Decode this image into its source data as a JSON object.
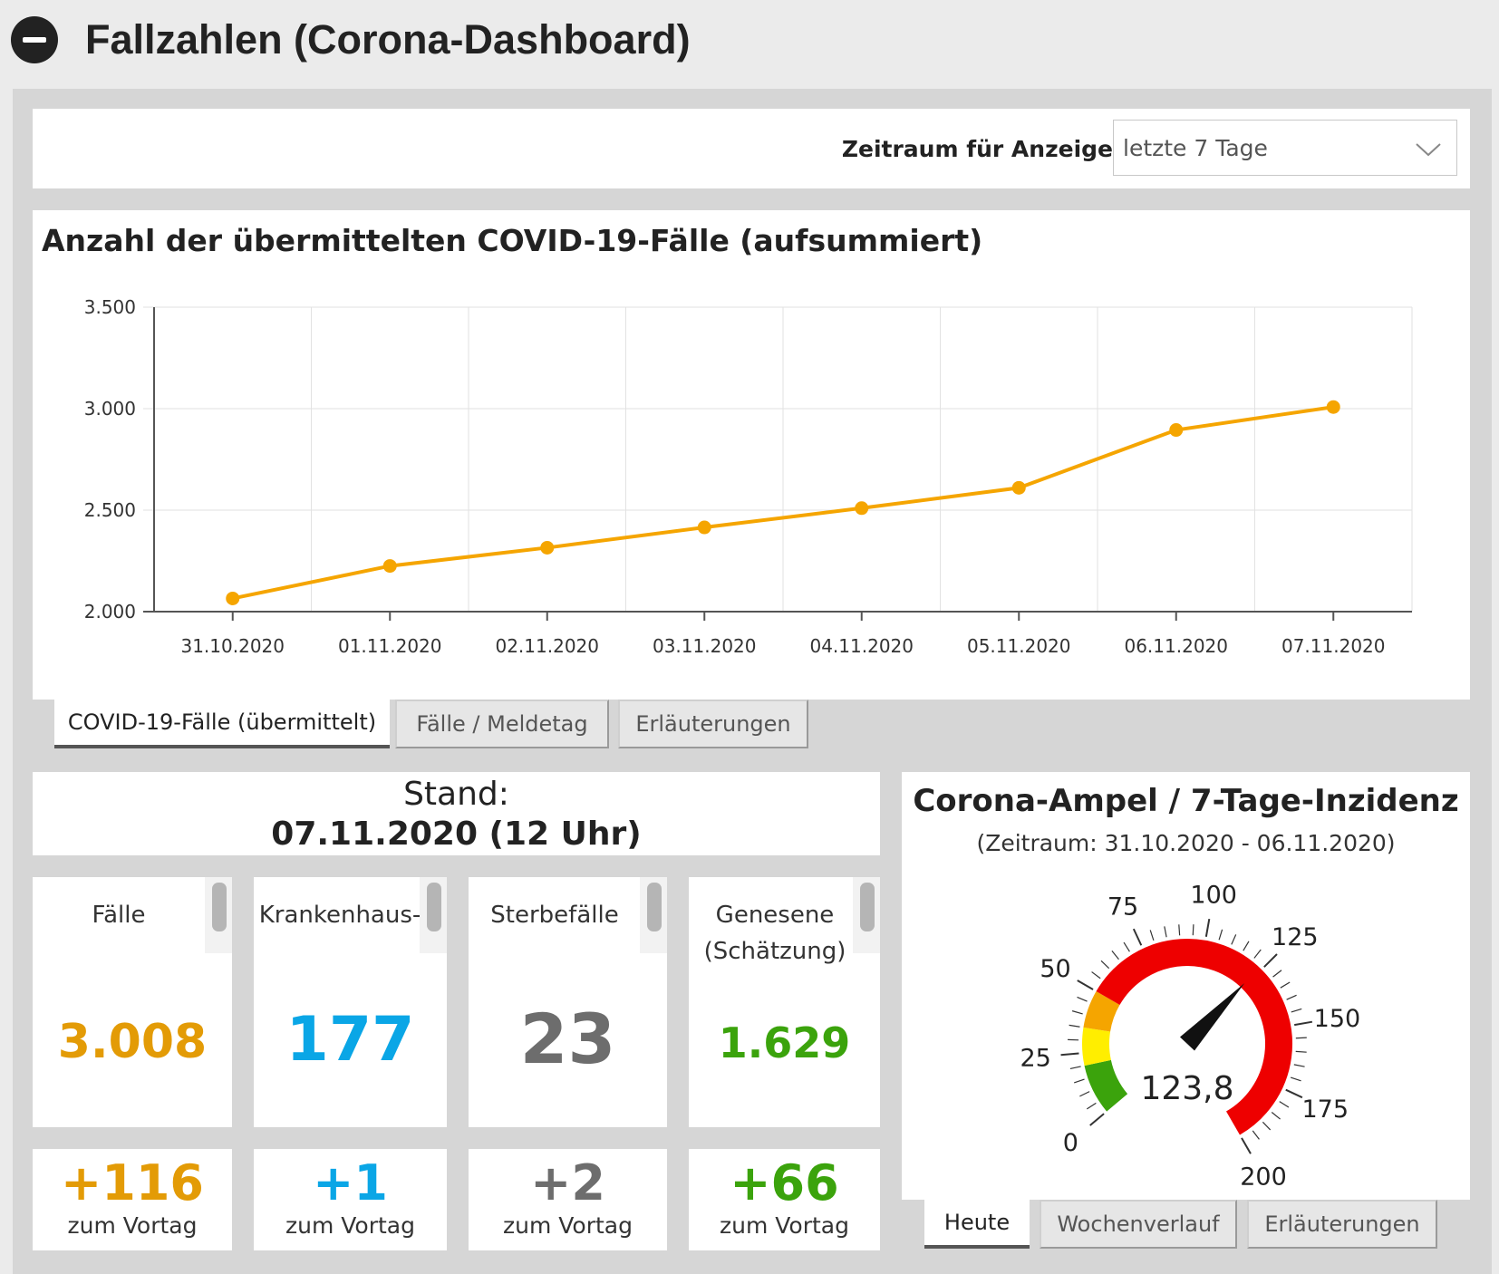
{
  "header": {
    "title": "Fallzahlen (Corona-Dashboard)"
  },
  "filter": {
    "label": "Zeitraum für Anzeige:",
    "selected": "letzte 7 Tage"
  },
  "chart_panel": {
    "tabs": [
      {
        "label": "COVID-19-Fälle (übermittelt)",
        "active": true
      },
      {
        "label": "Fälle / Meldetag",
        "active": false
      },
      {
        "label": "Erläuterungen",
        "active": false
      }
    ]
  },
  "chart_data": {
    "type": "line",
    "title": "Anzahl der übermittelten COVID-19-Fälle (aufsummiert)",
    "categories": [
      "31.10.2020",
      "01.11.2020",
      "02.11.2020",
      "03.11.2020",
      "04.11.2020",
      "05.11.2020",
      "06.11.2020",
      "07.11.2020"
    ],
    "values": [
      2065,
      2225,
      2315,
      2415,
      2510,
      2610,
      2895,
      3008
    ],
    "ylim": [
      2000,
      3500
    ],
    "yticks": [
      2000,
      2500,
      3000,
      3500
    ],
    "ytick_labels": [
      "2.000",
      "2.500",
      "3.000",
      "3.500"
    ],
    "color": "#f5a500",
    "grid": true,
    "xlabel": "",
    "ylabel": ""
  },
  "stand": {
    "label": "Stand:",
    "date": "07.11.2020 (12 Uhr)"
  },
  "kpis": [
    {
      "label": "Fälle",
      "value": "3.008",
      "delta": "+116",
      "delta_label": "zum Vortag",
      "color": "#e39b06"
    },
    {
      "label": "Krankenhaus-",
      "value": "177",
      "delta": "+1",
      "delta_label": "zum Vortag",
      "color": "#0aa6e6"
    },
    {
      "label": "Sterbefälle",
      "value": "23",
      "delta": "+2",
      "delta_label": "zum Vortag",
      "color": "#6d6d6d"
    },
    {
      "label": "Genesene (Schätzung)",
      "value": "1.629",
      "delta": "+66",
      "delta_label": "zum Vortag",
      "color": "#3ba30c"
    }
  ],
  "ampel": {
    "title": "Corona-Ampel / 7-Tage-Inzidenz",
    "range": "(Zeitraum: 31.10.2020 - 06.11.2020)",
    "value": 123.8,
    "value_label": "123,8",
    "scale_min": 0,
    "scale_max": 200,
    "scale_labels": [
      "0",
      "25",
      "50",
      "75",
      "100",
      "125",
      "150",
      "175",
      "200"
    ],
    "bands": [
      {
        "from": 0,
        "to": 20,
        "color": "#3ba30c"
      },
      {
        "from": 20,
        "to": 35,
        "color": "#ffee00"
      },
      {
        "from": 35,
        "to": 50,
        "color": "#f5a500"
      },
      {
        "from": 50,
        "to": 200,
        "color": "#ee0000"
      }
    ],
    "tabs": [
      {
        "label": "Heute",
        "active": true
      },
      {
        "label": "Wochenverlauf",
        "active": false
      },
      {
        "label": "Erläuterungen",
        "active": false
      }
    ]
  }
}
